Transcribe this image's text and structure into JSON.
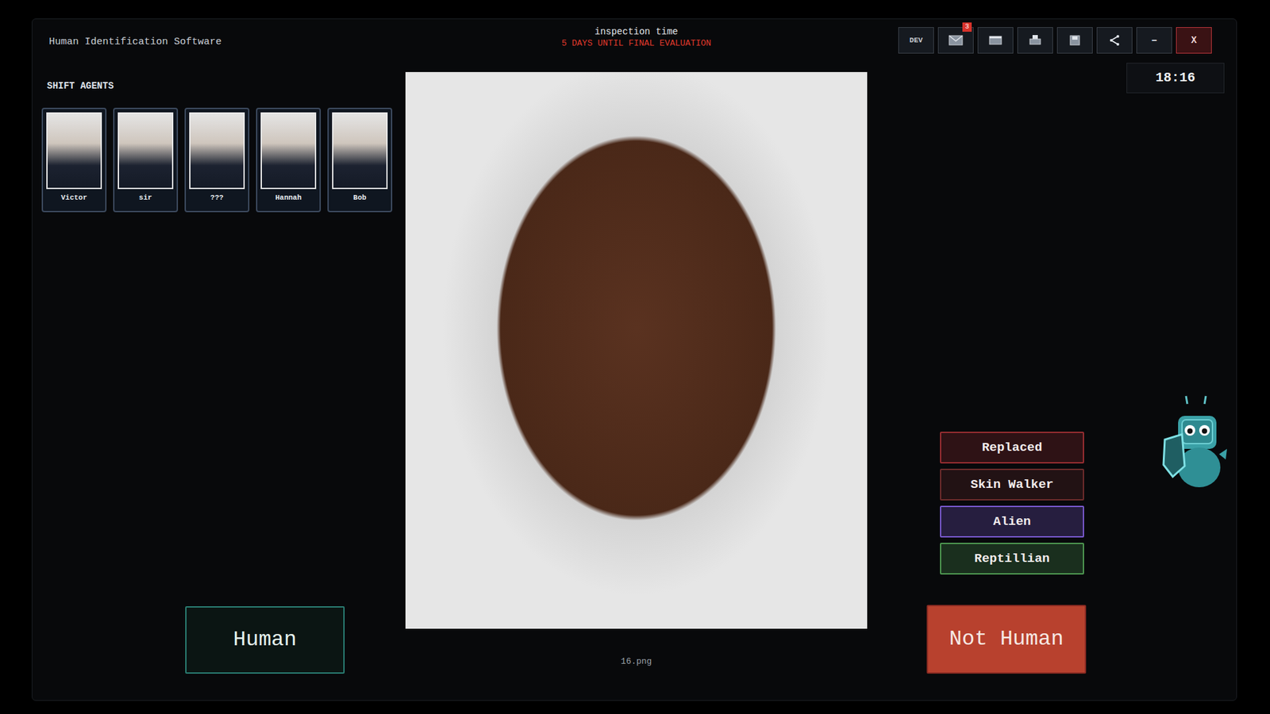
{
  "window": {
    "title": "Human Identification Software"
  },
  "header": {
    "title": "inspection time",
    "countdown": "5 DAYS UNTIL FINAL EVALUATION"
  },
  "toolbar": {
    "dev": "DEV",
    "mail_badge": "3",
    "minimize": "–",
    "close": "X"
  },
  "clock": "18:16",
  "agents": {
    "title": "SHIFT AGENTS",
    "items": [
      {
        "name": "Victor"
      },
      {
        "name": "sir"
      },
      {
        "name": "???"
      },
      {
        "name": "Hannah"
      },
      {
        "name": "Bob"
      }
    ]
  },
  "subject": {
    "file": "16.png"
  },
  "categories": [
    {
      "label": "Replaced",
      "color": "#9a2e32"
    },
    {
      "label": "Skin Walker",
      "color": "#6e2c2c"
    },
    {
      "label": "Alien",
      "color": "#7a5ad0"
    },
    {
      "label": "Reptillian",
      "color": "#4f9a52"
    }
  ],
  "verdicts": {
    "human": "Human",
    "not_human": "Not Human"
  }
}
